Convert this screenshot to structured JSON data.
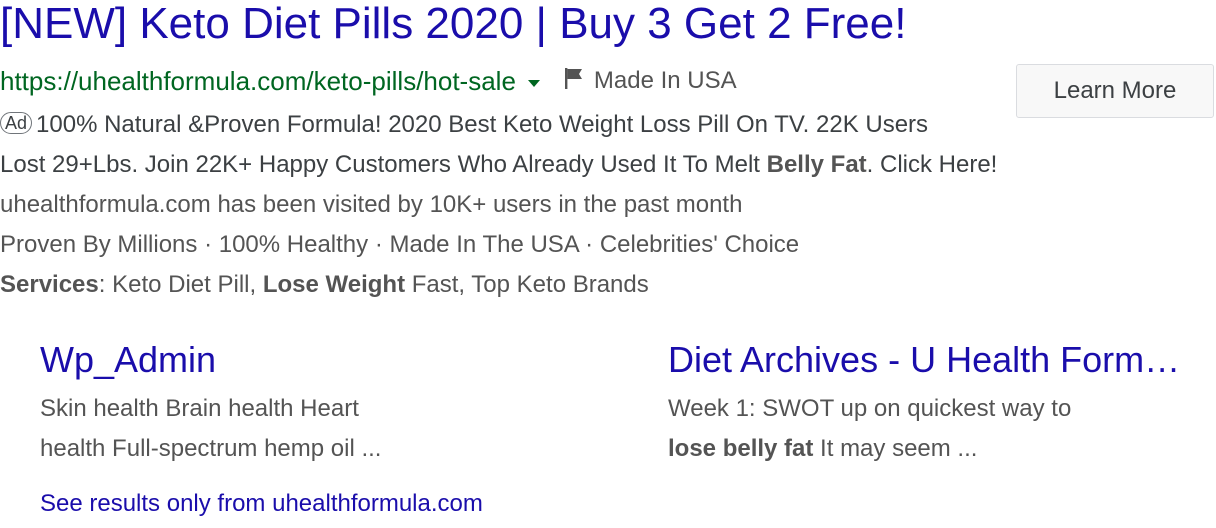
{
  "ad": {
    "title": "[NEW] Keto Diet Pills 2020 | Buy 3 Get 2 Free!",
    "url": "https://uhealthformula.com/keto-pills/hot-sale",
    "flag_icon": "flag-icon",
    "made_in": "Made In USA",
    "badge": "Ad",
    "cta_button": "Learn More",
    "description": {
      "line1": "100% Natural &Proven Formula! 2020 Best Keto Weight Loss Pill On TV. 22K Users",
      "line2_pre": "Lost 29+Lbs. Join 22K+ Happy Customers Who Already Used It To Melt ",
      "line2_bold": "Belly Fat",
      "line2_post": ". Click Here!",
      "visited": "uhealthformula.com has been visited by 10K+ users in the past month",
      "callouts": "Proven By Millions · 100% Healthy · Made In The USA · Celebrities' Choice",
      "services_label": "Services",
      "services_a": ": Keto Diet Pill, ",
      "services_bold": "Lose Weight",
      "services_b": " Fast, Top Keto Brands"
    },
    "sitelinks": [
      {
        "title": "Wp_Admin",
        "line1": "Skin health Brain health Heart",
        "line2": "health Full-spectrum hemp oil ..."
      },
      {
        "title": "Diet Archives - U Health Form…",
        "line1": "Week 1: SWOT up on quickest way to",
        "line2_bold": "lose belly fat",
        "line2_rest": " It may seem ..."
      }
    ],
    "see_results": "See results only from uhealthformula.com"
  },
  "colors": {
    "link_blue": "#1a0dab",
    "url_green": "#006621",
    "text_gray": "#545454"
  }
}
